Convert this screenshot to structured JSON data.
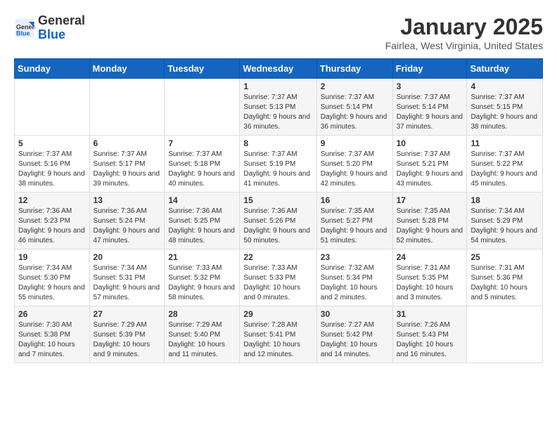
{
  "header": {
    "logo_line1": "General",
    "logo_line2": "Blue",
    "title": "January 2025",
    "subtitle": "Fairlea, West Virginia, United States"
  },
  "weekdays": [
    "Sunday",
    "Monday",
    "Tuesday",
    "Wednesday",
    "Thursday",
    "Friday",
    "Saturday"
  ],
  "weeks": [
    [
      {
        "day": "",
        "detail": ""
      },
      {
        "day": "",
        "detail": ""
      },
      {
        "day": "",
        "detail": ""
      },
      {
        "day": "1",
        "detail": "Sunrise: 7:37 AM\nSunset: 5:13 PM\nDaylight: 9 hours and 36 minutes."
      },
      {
        "day": "2",
        "detail": "Sunrise: 7:37 AM\nSunset: 5:14 PM\nDaylight: 9 hours and 36 minutes."
      },
      {
        "day": "3",
        "detail": "Sunrise: 7:37 AM\nSunset: 5:14 PM\nDaylight: 9 hours and 37 minutes."
      },
      {
        "day": "4",
        "detail": "Sunrise: 7:37 AM\nSunset: 5:15 PM\nDaylight: 9 hours and 38 minutes."
      }
    ],
    [
      {
        "day": "5",
        "detail": "Sunrise: 7:37 AM\nSunset: 5:16 PM\nDaylight: 9 hours and 38 minutes."
      },
      {
        "day": "6",
        "detail": "Sunrise: 7:37 AM\nSunset: 5:17 PM\nDaylight: 9 hours and 39 minutes."
      },
      {
        "day": "7",
        "detail": "Sunrise: 7:37 AM\nSunset: 5:18 PM\nDaylight: 9 hours and 40 minutes."
      },
      {
        "day": "8",
        "detail": "Sunrise: 7:37 AM\nSunset: 5:19 PM\nDaylight: 9 hours and 41 minutes."
      },
      {
        "day": "9",
        "detail": "Sunrise: 7:37 AM\nSunset: 5:20 PM\nDaylight: 9 hours and 42 minutes."
      },
      {
        "day": "10",
        "detail": "Sunrise: 7:37 AM\nSunset: 5:21 PM\nDaylight: 9 hours and 43 minutes."
      },
      {
        "day": "11",
        "detail": "Sunrise: 7:37 AM\nSunset: 5:22 PM\nDaylight: 9 hours and 45 minutes."
      }
    ],
    [
      {
        "day": "12",
        "detail": "Sunrise: 7:36 AM\nSunset: 5:23 PM\nDaylight: 9 hours and 46 minutes."
      },
      {
        "day": "13",
        "detail": "Sunrise: 7:36 AM\nSunset: 5:24 PM\nDaylight: 9 hours and 47 minutes."
      },
      {
        "day": "14",
        "detail": "Sunrise: 7:36 AM\nSunset: 5:25 PM\nDaylight: 9 hours and 48 minutes."
      },
      {
        "day": "15",
        "detail": "Sunrise: 7:36 AM\nSunset: 5:26 PM\nDaylight: 9 hours and 50 minutes."
      },
      {
        "day": "16",
        "detail": "Sunrise: 7:35 AM\nSunset: 5:27 PM\nDaylight: 9 hours and 51 minutes."
      },
      {
        "day": "17",
        "detail": "Sunrise: 7:35 AM\nSunset: 5:28 PM\nDaylight: 9 hours and 52 minutes."
      },
      {
        "day": "18",
        "detail": "Sunrise: 7:34 AM\nSunset: 5:29 PM\nDaylight: 9 hours and 54 minutes."
      }
    ],
    [
      {
        "day": "19",
        "detail": "Sunrise: 7:34 AM\nSunset: 5:30 PM\nDaylight: 9 hours and 55 minutes."
      },
      {
        "day": "20",
        "detail": "Sunrise: 7:34 AM\nSunset: 5:31 PM\nDaylight: 9 hours and 57 minutes."
      },
      {
        "day": "21",
        "detail": "Sunrise: 7:33 AM\nSunset: 5:32 PM\nDaylight: 9 hours and 58 minutes."
      },
      {
        "day": "22",
        "detail": "Sunrise: 7:33 AM\nSunset: 5:33 PM\nDaylight: 10 hours and 0 minutes."
      },
      {
        "day": "23",
        "detail": "Sunrise: 7:32 AM\nSunset: 5:34 PM\nDaylight: 10 hours and 2 minutes."
      },
      {
        "day": "24",
        "detail": "Sunrise: 7:31 AM\nSunset: 5:35 PM\nDaylight: 10 hours and 3 minutes."
      },
      {
        "day": "25",
        "detail": "Sunrise: 7:31 AM\nSunset: 5:36 PM\nDaylight: 10 hours and 5 minutes."
      }
    ],
    [
      {
        "day": "26",
        "detail": "Sunrise: 7:30 AM\nSunset: 5:38 PM\nDaylight: 10 hours and 7 minutes."
      },
      {
        "day": "27",
        "detail": "Sunrise: 7:29 AM\nSunset: 5:39 PM\nDaylight: 10 hours and 9 minutes."
      },
      {
        "day": "28",
        "detail": "Sunrise: 7:29 AM\nSunset: 5:40 PM\nDaylight: 10 hours and 11 minutes."
      },
      {
        "day": "29",
        "detail": "Sunrise: 7:28 AM\nSunset: 5:41 PM\nDaylight: 10 hours and 12 minutes."
      },
      {
        "day": "30",
        "detail": "Sunrise: 7:27 AM\nSunset: 5:42 PM\nDaylight: 10 hours and 14 minutes."
      },
      {
        "day": "31",
        "detail": "Sunrise: 7:26 AM\nSunset: 5:43 PM\nDaylight: 10 hours and 16 minutes."
      },
      {
        "day": "",
        "detail": ""
      }
    ]
  ]
}
